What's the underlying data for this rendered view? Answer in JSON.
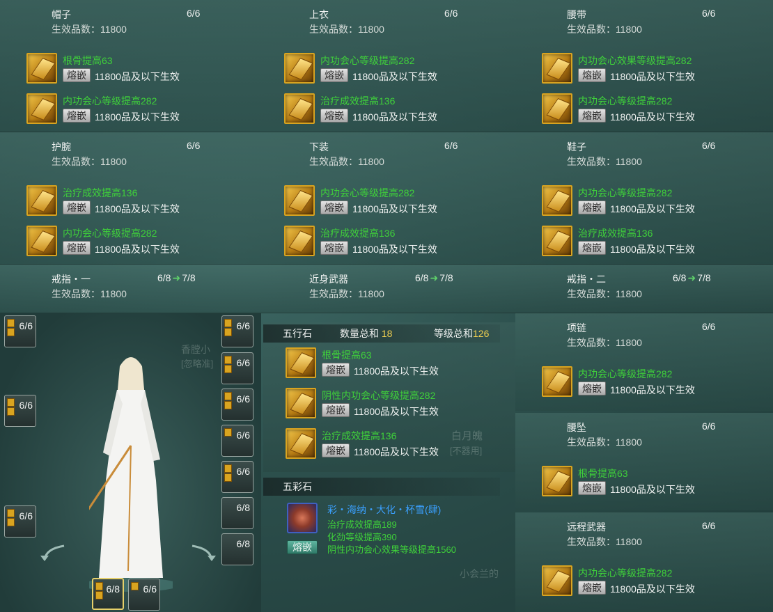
{
  "colors": {
    "gem_name": "#3fd13a",
    "accent_gold": "#f0d050",
    "colored_gem_name": "#3aa0ff",
    "increase_arrow": "#5fd06a"
  },
  "equipment_panels": [
    {
      "slot": "帽子",
      "count": "6/6",
      "quality": "生效品数：11800",
      "gems": [
        {
          "name": "根骨提高63",
          "button": "熔嵌",
          "effect": "11800品及以下生效"
        },
        {
          "name": "内功会心等级提高282",
          "button": "熔嵌",
          "effect": "11800品及以下生效"
        }
      ]
    },
    {
      "slot": "上衣",
      "count": "6/6",
      "quality": "生效品数：11800",
      "gems": [
        {
          "name": "内功会心等级提高282",
          "button": "熔嵌",
          "effect": "11800品及以下生效"
        },
        {
          "name": "治疗成效提高136",
          "button": "熔嵌",
          "effect": "11800品及以下生效"
        }
      ]
    },
    {
      "slot": "腰带",
      "count": "6/6",
      "quality": "生效品数：11800",
      "gems": [
        {
          "name": "内功会心效果等级提高282",
          "button": "熔嵌",
          "effect": "11800品及以下生效"
        },
        {
          "name": "内功会心等级提高282",
          "button": "熔嵌",
          "effect": "11800品及以下生效"
        }
      ]
    },
    {
      "slot": "护腕",
      "count": "6/6",
      "quality": "生效品数：11800",
      "gems": [
        {
          "name": "治疗成效提高136",
          "button": "熔嵌",
          "effect": "11800品及以下生效"
        },
        {
          "name": "内功会心等级提高282",
          "button": "熔嵌",
          "effect": "11800品及以下生效"
        }
      ]
    },
    {
      "slot": "下装",
      "count": "6/6",
      "quality": "生效品数：11800",
      "gems": [
        {
          "name": "内功会心等级提高282",
          "button": "熔嵌",
          "effect": "11800品及以下生效"
        },
        {
          "name": "治疗成效提高136",
          "button": "熔嵌",
          "effect": "11800品及以下生效"
        }
      ]
    },
    {
      "slot": "鞋子",
      "count": "6/6",
      "quality": "生效品数：11800",
      "gems": [
        {
          "name": "内功会心等级提高282",
          "button": "熔嵌",
          "effect": "11800品及以下生效"
        },
        {
          "name": "治疗成效提高136",
          "button": "熔嵌",
          "effect": "11800品及以下生效"
        }
      ]
    }
  ],
  "upgrade_rows": [
    {
      "slot": "戒指・一",
      "count": "6/8",
      "next": "7/8",
      "quality": "生效品数：11800"
    },
    {
      "slot": "近身武器",
      "count": "6/8",
      "next": "7/8",
      "quality": "生效品数：11800"
    },
    {
      "slot": "戒指・二",
      "count": "6/8",
      "next": "7/8",
      "quality": "生效品数：11800"
    }
  ],
  "wuxing": {
    "label": "五行石",
    "count_label": "数量总和",
    "count_value": "18",
    "level_label": "等级总和",
    "level_value": "126",
    "gems": [
      {
        "name": "根骨提高63",
        "button": "熔嵌",
        "effect": "11800品及以下生效"
      },
      {
        "name": "阴性内功会心等级提高282",
        "button": "熔嵌",
        "effect": "11800品及以下生效"
      },
      {
        "name": "治疗成效提高136",
        "button": "熔嵌",
        "effect": "11800品及以下生效"
      }
    ]
  },
  "wucai": {
    "label": "五彩石",
    "name": "彩・海纳・大化・杯雪(肆)",
    "attrs": [
      "治疗成效提高189",
      "化劲等级提高390",
      "阴性内功会心效果等级提高1560"
    ],
    "button": "熔嵌"
  },
  "right_panels": [
    {
      "slot": "项链",
      "count": "6/6",
      "quality": "生效品数：11800",
      "gem": {
        "name": "内功会心等级提高282",
        "button": "熔嵌",
        "effect": "11800品及以下生效"
      }
    },
    {
      "slot": "腰坠",
      "count": "6/6",
      "quality": "生效品数：11800",
      "gem": {
        "name": "根骨提高63",
        "button": "熔嵌",
        "effect": "11800品及以下生效"
      }
    },
    {
      "slot": "远程武器",
      "count": "6/6",
      "quality": "生效品数：11800",
      "gem": {
        "name": "内功会心等级提高282",
        "button": "熔嵌",
        "effect": "11800品及以下生效"
      }
    }
  ],
  "equip_slots": {
    "left": [
      "6/6",
      "6/6",
      "6/6"
    ],
    "right": [
      "6/6",
      "6/6",
      "6/6",
      "6/6",
      "6/6",
      "6/8",
      "6/8"
    ],
    "bottom": [
      "6/8",
      "6/6"
    ]
  },
  "watermarks": [
    "香膛小",
    "[忽略准]",
    "白月魄",
    "[不器用]",
    "小会兰的"
  ]
}
